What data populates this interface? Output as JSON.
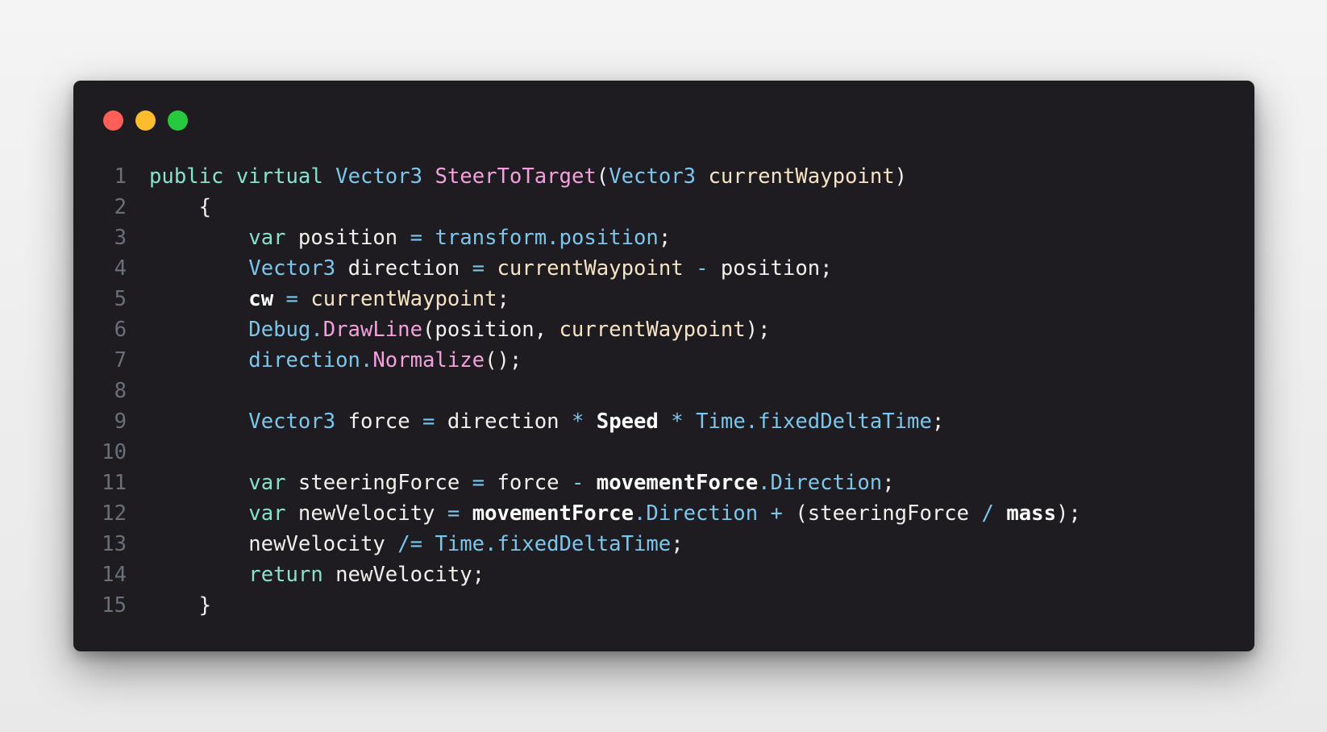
{
  "window": {
    "buttons": [
      {
        "name": "close",
        "color": "#ff5f56"
      },
      {
        "name": "minimize",
        "color": "#ffbd2e"
      },
      {
        "name": "maximize",
        "color": "#27c93f"
      }
    ]
  },
  "colors": {
    "keyword": "#86e1cf",
    "type": "#7cc6ec",
    "function": "#f3a0dc",
    "identifier": "#f6e3c4",
    "operator": "#7cc6ec",
    "plain": "#f1f0ec",
    "line_number": "#6b6f7a",
    "background": "#1e1c21"
  },
  "code": {
    "language": "csharp",
    "lines": [
      {
        "number": "1",
        "tokens": [
          [
            "kw",
            "public"
          ],
          [
            "pl",
            " "
          ],
          [
            "kw",
            "virtual"
          ],
          [
            "pl",
            " "
          ],
          [
            "ty",
            "Vector3"
          ],
          [
            "pl",
            " "
          ],
          [
            "fn",
            "SteerToTarget"
          ],
          [
            "pl",
            "("
          ],
          [
            "ty",
            "Vector3"
          ],
          [
            "pl",
            " "
          ],
          [
            "id",
            "currentWaypoint"
          ],
          [
            "pl",
            ")"
          ]
        ]
      },
      {
        "number": "2",
        "tokens": [
          [
            "pl",
            "    {"
          ]
        ]
      },
      {
        "number": "3",
        "tokens": [
          [
            "pl",
            "        "
          ],
          [
            "kw",
            "var"
          ],
          [
            "pl",
            " position "
          ],
          [
            "op",
            "="
          ],
          [
            "pl",
            " "
          ],
          [
            "ty",
            "transform.position"
          ],
          [
            "pl",
            ";"
          ]
        ]
      },
      {
        "number": "4",
        "tokens": [
          [
            "pl",
            "        "
          ],
          [
            "ty",
            "Vector3"
          ],
          [
            "pl",
            " direction "
          ],
          [
            "op",
            "="
          ],
          [
            "pl",
            " "
          ],
          [
            "id",
            "currentWaypoint"
          ],
          [
            "pl",
            " "
          ],
          [
            "op",
            "-"
          ],
          [
            "pl",
            " position;"
          ]
        ]
      },
      {
        "number": "5",
        "tokens": [
          [
            "pl",
            "        "
          ],
          [
            "bd",
            "cw"
          ],
          [
            "pl",
            " "
          ],
          [
            "op",
            "="
          ],
          [
            "pl",
            " "
          ],
          [
            "id",
            "currentWaypoint"
          ],
          [
            "pl",
            ";"
          ]
        ]
      },
      {
        "number": "6",
        "tokens": [
          [
            "pl",
            "        "
          ],
          [
            "ty",
            "Debug."
          ],
          [
            "fn",
            "DrawLine"
          ],
          [
            "pl",
            "(position, "
          ],
          [
            "id",
            "currentWaypoint"
          ],
          [
            "pl",
            ");"
          ]
        ]
      },
      {
        "number": "7",
        "tokens": [
          [
            "pl",
            "        "
          ],
          [
            "ty",
            "direction."
          ],
          [
            "fn",
            "Normalize"
          ],
          [
            "pl",
            "();"
          ]
        ]
      },
      {
        "number": "8",
        "tokens": []
      },
      {
        "number": "9",
        "tokens": [
          [
            "pl",
            "        "
          ],
          [
            "ty",
            "Vector3"
          ],
          [
            "pl",
            " force "
          ],
          [
            "op",
            "="
          ],
          [
            "pl",
            " direction "
          ],
          [
            "op",
            "*"
          ],
          [
            "pl",
            " "
          ],
          [
            "bd",
            "Speed"
          ],
          [
            "pl",
            " "
          ],
          [
            "op",
            "*"
          ],
          [
            "pl",
            " "
          ],
          [
            "ty",
            "Time.fixedDeltaTime"
          ],
          [
            "pl",
            ";"
          ]
        ]
      },
      {
        "number": "10",
        "tokens": []
      },
      {
        "number": "11",
        "tokens": [
          [
            "pl",
            "        "
          ],
          [
            "kw",
            "var"
          ],
          [
            "pl",
            " steeringForce "
          ],
          [
            "op",
            "="
          ],
          [
            "pl",
            " force "
          ],
          [
            "op",
            "-"
          ],
          [
            "pl",
            " "
          ],
          [
            "bd",
            "movementForce"
          ],
          [
            "ty",
            ".Direction"
          ],
          [
            "pl",
            ";"
          ]
        ]
      },
      {
        "number": "12",
        "tokens": [
          [
            "pl",
            "        "
          ],
          [
            "kw",
            "var"
          ],
          [
            "pl",
            " newVelocity "
          ],
          [
            "op",
            "="
          ],
          [
            "pl",
            " "
          ],
          [
            "bd",
            "movementForce"
          ],
          [
            "ty",
            ".Direction"
          ],
          [
            "pl",
            " "
          ],
          [
            "op",
            "+"
          ],
          [
            "pl",
            " (steeringForce "
          ],
          [
            "op",
            "/"
          ],
          [
            "pl",
            " "
          ],
          [
            "bd",
            "mass"
          ],
          [
            "pl",
            ");"
          ]
        ]
      },
      {
        "number": "13",
        "tokens": [
          [
            "pl",
            "        newVelocity "
          ],
          [
            "op",
            "/="
          ],
          [
            "pl",
            " "
          ],
          [
            "ty",
            "Time.fixedDeltaTime"
          ],
          [
            "pl",
            ";"
          ]
        ]
      },
      {
        "number": "14",
        "tokens": [
          [
            "pl",
            "        "
          ],
          [
            "kw",
            "return"
          ],
          [
            "pl",
            " newVelocity;"
          ]
        ]
      },
      {
        "number": "15",
        "tokens": [
          [
            "pl",
            "    }"
          ]
        ]
      }
    ]
  }
}
